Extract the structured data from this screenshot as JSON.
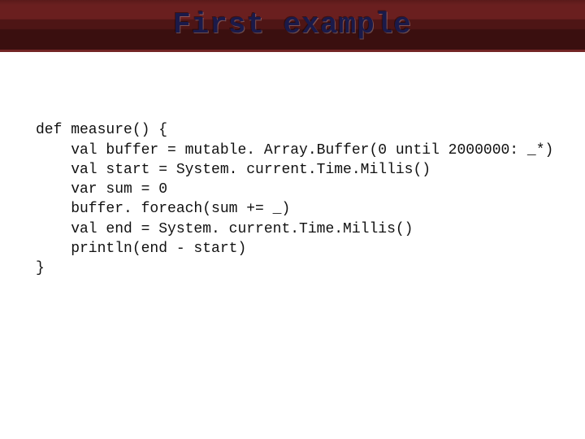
{
  "header": {
    "title": "First example"
  },
  "code": {
    "lines": [
      "def measure() {",
      "    val buffer = mutable. Array.Buffer(0 until 2000000: _*)",
      "    val start = System. current.Time.Millis()",
      "    var sum = 0",
      "    buffer. foreach(sum += _)",
      "    val end = System. current.Time.Millis()",
      "    println(end - start)",
      "}"
    ]
  }
}
